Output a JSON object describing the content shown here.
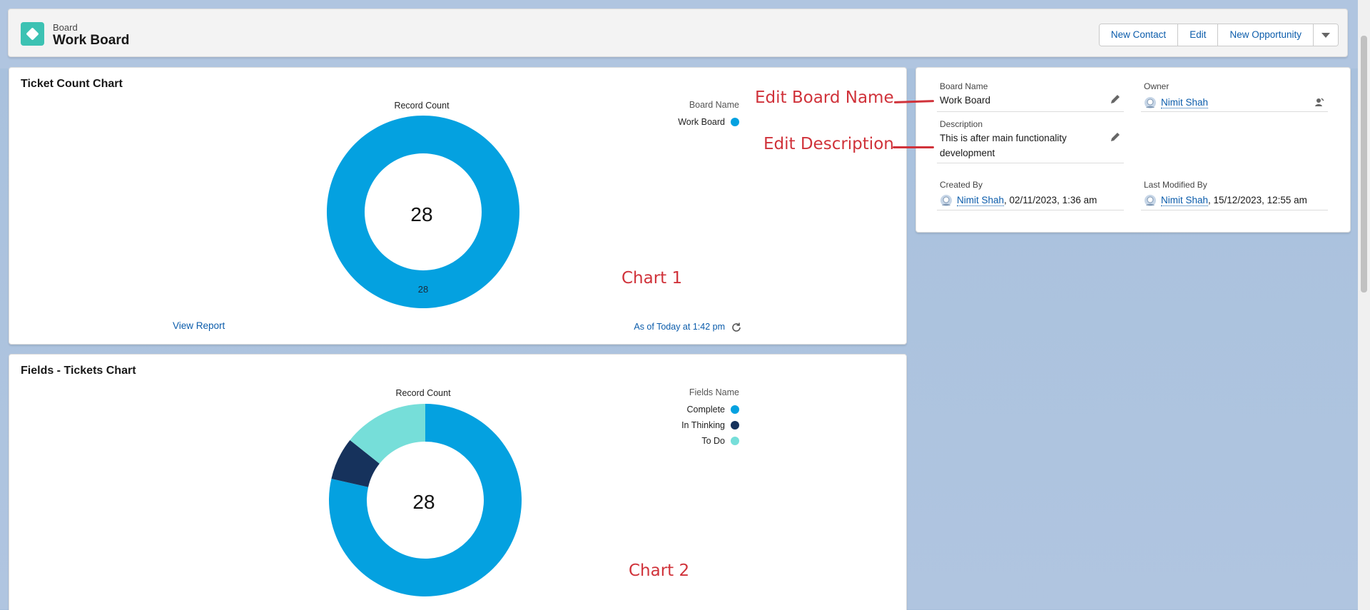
{
  "header": {
    "object_type": "Board",
    "record_title": "Work Board",
    "actions": [
      "New Contact",
      "Edit",
      "New Opportunity"
    ]
  },
  "chart1": {
    "card_title": "Ticket Count Chart",
    "caption": "Record Count",
    "center_value": "28",
    "legend_title": "Board Name",
    "view_report": "View Report",
    "refresh_text": "As of Today at 1:42 pm",
    "annotation": "Chart 1",
    "chart_data": {
      "type": "pie",
      "title": "Record Count",
      "legend_title": "Board Name",
      "categories": [
        "Work Board"
      ],
      "values": [
        28
      ],
      "colors": [
        "#04a1e0"
      ],
      "labels": [
        "28"
      ],
      "total": 28
    }
  },
  "chart2": {
    "card_title": "Fields - Tickets Chart",
    "caption": "Record Count",
    "center_value": "28",
    "legend_title": "Fields Name",
    "annotation": "Chart 2",
    "chart_data": {
      "type": "pie",
      "title": "Record Count",
      "legend_title": "Fields Name",
      "categories": [
        "Complete",
        "In Thinking",
        "To Do"
      ],
      "values": [
        22,
        2,
        4
      ],
      "colors": [
        "#04a1e0",
        "#16325c",
        "#76ded9"
      ],
      "total": 28
    }
  },
  "details": {
    "board_name_label": "Board Name",
    "board_name_value": "Work Board",
    "owner_label": "Owner",
    "owner_value": "Nimit Shah",
    "description_label": "Description",
    "description_value": "This is after main functionality development",
    "created_by_label": "Created By",
    "created_by_user": "Nimit Shah",
    "created_by_date": ", 02/11/2023, 1:36 am",
    "modified_by_label": "Last Modified By",
    "modified_by_user": "Nimit Shah",
    "modified_by_date": ", 15/12/2023, 12:55 am"
  },
  "annotations": {
    "edit_board_name": "Edit Board Name",
    "edit_description": "Edit Description"
  },
  "colors": {
    "accent": "#0b5cab",
    "annotation": "#d0323a",
    "board_icon": "#3cc2b3"
  }
}
